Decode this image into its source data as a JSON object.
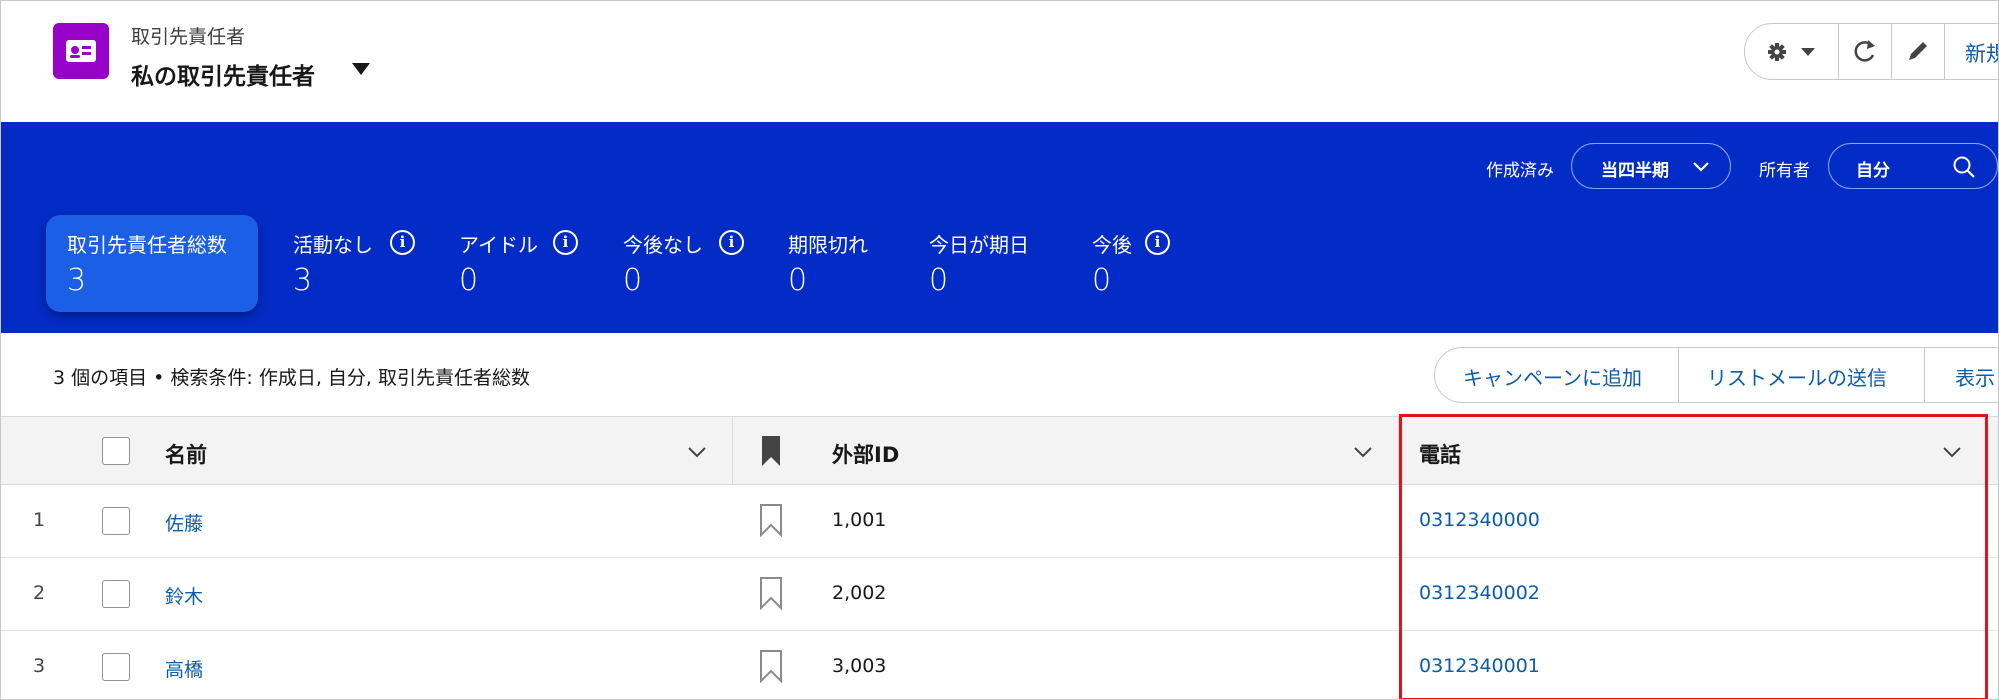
{
  "header": {
    "object_label": "取引先責任者",
    "list_title": "私の取引先責任者",
    "new_button_label": "新規"
  },
  "panel": {
    "filters": {
      "created_label": "作成済み",
      "created_value": "当四半期",
      "owner_label": "所有者",
      "owner_value": "自分"
    },
    "tiles": [
      {
        "label": "取引先責任者総数",
        "value": "3"
      },
      {
        "label": "活動なし",
        "value": "3"
      },
      {
        "label": "アイドル",
        "value": "0"
      },
      {
        "label": "今後なし",
        "value": "0"
      },
      {
        "label": "期限切れ",
        "value": "0"
      },
      {
        "label": "今日が期日",
        "value": "0"
      },
      {
        "label": "今後",
        "value": "0"
      }
    ]
  },
  "list": {
    "summary": "3 個の項目 • 検索条件: 作成日, 自分, 取引先責任者総数",
    "actions": [
      "キャンペーンに追加",
      "リストメールの送信",
      "表示"
    ]
  },
  "table": {
    "columns": [
      "名前",
      "外部ID",
      "電話"
    ],
    "rows": [
      {
        "index": "1",
        "name": "佐藤",
        "external_id": "1,001",
        "phone": "0312340000"
      },
      {
        "index": "2",
        "name": "鈴木",
        "external_id": "2,002",
        "phone": "0312340002"
      },
      {
        "index": "3",
        "name": "高橋",
        "external_id": "3,003",
        "phone": "0312340001"
      }
    ]
  },
  "colors": {
    "panel_blue": "#032cc6",
    "active_tile": "#1b5fe6",
    "link_blue": "#0b5cab",
    "object_icon": "#9602c7",
    "highlight_red": "#e0151b"
  }
}
